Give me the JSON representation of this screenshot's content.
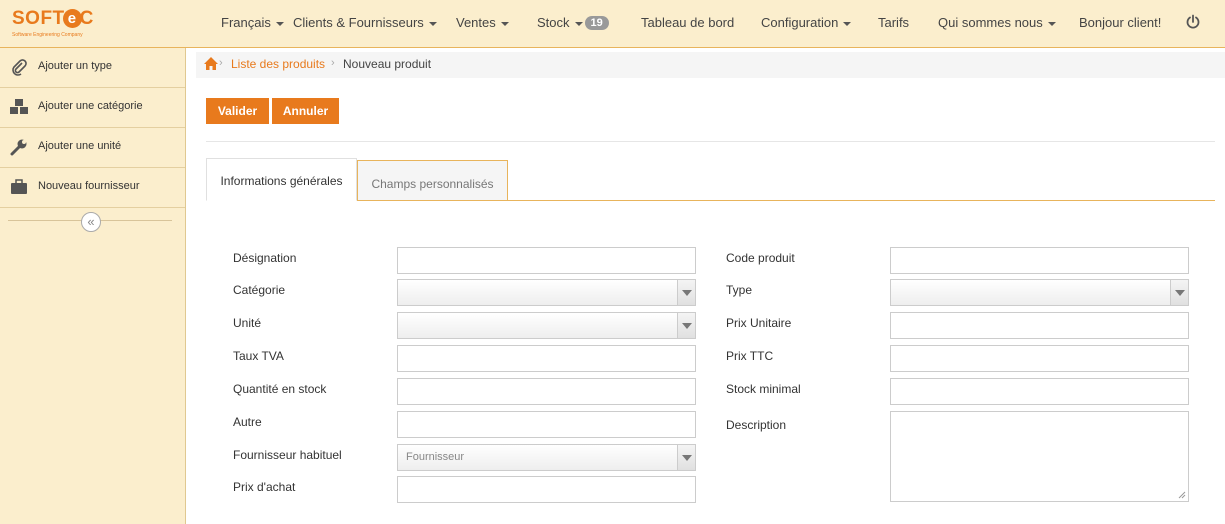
{
  "brand": {
    "name_prefix": "SOFT",
    "name_mid": "e",
    "name_suffix": "C",
    "tagline": "Software Engineering Company",
    "accent": "#e87a1d"
  },
  "nav": {
    "language": "Français",
    "clients": "Clients & Fournisseurs",
    "sales": "Ventes",
    "stock": "Stock",
    "stock_badge": "19",
    "dashboard": "Tableau de bord",
    "config": "Configuration",
    "pricing": "Tarifs",
    "about": "Qui sommes nous",
    "greeting": "Bonjour client!",
    "power_icon": "power-icon"
  },
  "sidebar": {
    "items": [
      {
        "label": "Ajouter un type",
        "icon": "paperclip-icon"
      },
      {
        "label": "Ajouter une catégorie",
        "icon": "cubes-icon"
      },
      {
        "label": "Ajouter une unité",
        "icon": "wrench-icon"
      },
      {
        "label": "Nouveau fournisseur",
        "icon": "briefcase-icon"
      }
    ],
    "collapse_icon": "«"
  },
  "breadcrumb": {
    "link": "Liste des produits",
    "current": "Nouveau produit"
  },
  "actions": {
    "validate": "Valider",
    "cancel": "Annuler"
  },
  "tabs": {
    "general": "Informations générales",
    "custom": "Champs personnalisés"
  },
  "form": {
    "left": {
      "designation": "Désignation",
      "category": "Catégorie",
      "unit": "Unité",
      "vat": "Taux TVA",
      "stock_qty": "Quantité en stock",
      "other": "Autre",
      "supplier": "Fournisseur habituel",
      "supplier_placeholder": "Fournisseur",
      "purchase_price": "Prix d'achat"
    },
    "right": {
      "product_code": "Code produit",
      "type": "Type",
      "unit_price": "Prix Unitaire",
      "price_ttc": "Prix TTC",
      "min_stock": "Stock minimal",
      "description": "Description"
    }
  }
}
